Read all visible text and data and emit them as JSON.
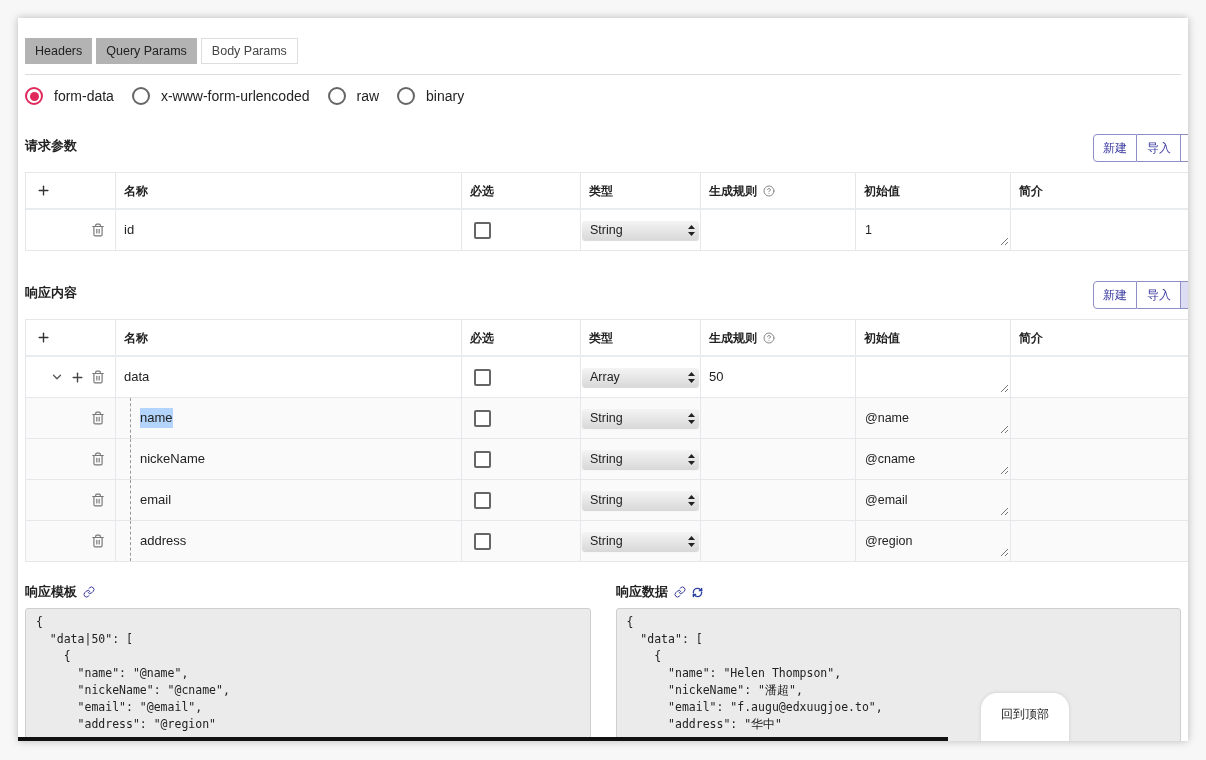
{
  "tabs": [
    {
      "label": "Headers",
      "selected": false
    },
    {
      "label": "Query Params",
      "selected": false
    },
    {
      "label": "Body Params",
      "selected": true
    }
  ],
  "body_types": [
    {
      "label": "form-data",
      "selected": true
    },
    {
      "label": "x-www-form-urlencoded",
      "selected": false
    },
    {
      "label": "raw",
      "selected": false
    },
    {
      "label": "binary",
      "selected": false
    }
  ],
  "sections": [
    {
      "title": "请求参数",
      "buttons": [
        "新建",
        "导入"
      ],
      "columns": [
        "名称",
        "必选",
        "类型",
        "生成规则",
        "初始值",
        "简介"
      ],
      "rows": [
        {
          "name": "id",
          "required": false,
          "type": "String",
          "initial": "1"
        }
      ]
    },
    {
      "title": "响应内容",
      "buttons": [
        "新建",
        "导入"
      ],
      "columns": [
        "名称",
        "必选",
        "类型",
        "生成规则",
        "初始值",
        "简介"
      ],
      "rows": [
        {
          "name": "data",
          "required": false,
          "type": "Array",
          "rule": "50",
          "expanded": true,
          "children": [
            {
              "name": "name",
              "required": false,
              "type": "String",
              "initial": "@name",
              "highlighted": true
            },
            {
              "name": "nickeName",
              "required": false,
              "type": "String",
              "initial": "@cname",
              "highlighted": false
            },
            {
              "name": "email",
              "required": false,
              "type": "String",
              "initial": "@email",
              "highlighted": false
            },
            {
              "name": "address",
              "required": false,
              "type": "String",
              "initial": "@region",
              "highlighted": false
            }
          ]
        }
      ]
    }
  ],
  "response_template": {
    "title": "响应模板",
    "lines": [
      "{",
      "  \"data|50\": [",
      "    {",
      "      \"name\": \"@name\",",
      "      \"nickeName\": \"@cname\",",
      "      \"email\": \"@email\",",
      "      \"address\": \"@region\""
    ]
  },
  "response_data": {
    "title": "响应数据",
    "lines": [
      "{",
      "  \"data\": [",
      "    {",
      "      \"name\": \"Helen Thompson\",",
      "      \"nickeName\": \"潘超\",",
      "      \"email\": \"f.augu@edxuugjoe.to\",",
      "      \"address\": \"华中\""
    ]
  },
  "back_to_top": "回到顶部"
}
